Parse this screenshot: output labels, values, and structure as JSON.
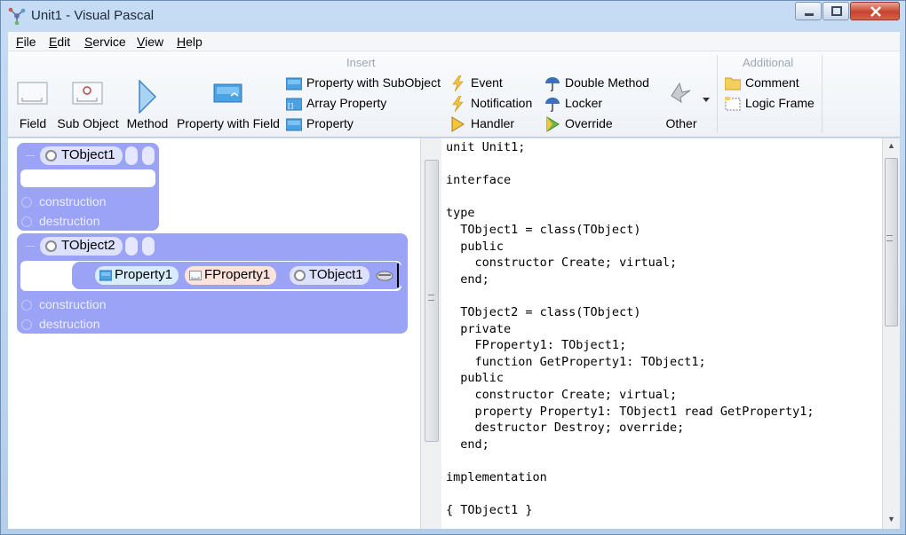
{
  "window": {
    "title": "Unit1 - Visual Pascal"
  },
  "menu": [
    {
      "label": "File",
      "underline": "F"
    },
    {
      "label": "Edit",
      "underline": "E"
    },
    {
      "label": "Service",
      "underline": "S"
    },
    {
      "label": "View",
      "underline": "V"
    },
    {
      "label": "Help",
      "underline": "H"
    }
  ],
  "ribbon": {
    "insert_title": "Insert",
    "additional_title": "Additional",
    "big_buttons": {
      "field": "Field",
      "sub_object": "Sub Object",
      "method": "Method",
      "property_with_field": "Property with Field",
      "other": "Other"
    },
    "small_buttons": {
      "property_with_subobject": "Property with SubObject",
      "array_property": "Array Property",
      "property": "Property",
      "event": "Event",
      "notification": "Notification",
      "handler": "Handler",
      "double_method": "Double Method",
      "locker": "Locker",
      "override": "Override",
      "comment": "Comment",
      "logic_frame": "Logic Frame"
    }
  },
  "designer": {
    "classes": [
      {
        "name": "TObject1",
        "construction": "construction",
        "destruction": "destruction"
      },
      {
        "name": "TObject2",
        "construction": "construction",
        "destruction": "destruction",
        "property": {
          "name": "Property1",
          "field": "FProperty1",
          "type": "TObject1"
        }
      }
    ]
  },
  "code_lines": [
    "unit Unit1;",
    "",
    "interface",
    "",
    "type",
    "  TObject1 = class(TObject)",
    "  public",
    "    constructor Create; virtual;",
    "  end;",
    "",
    "  TObject2 = class(TObject)",
    "  private",
    "    FProperty1: TObject1;",
    "    function GetProperty1: TObject1;",
    "  public",
    "    constructor Create; virtual;",
    "    property Property1: TObject1 read GetProperty1;",
    "    destructor Destroy; override;",
    "  end;",
    "",
    "implementation",
    "",
    "{ TObject1 }"
  ],
  "colors": {
    "class_box": "#9aa3f5",
    "pill": "#dde1fc",
    "accent": "#4a8fdc"
  }
}
